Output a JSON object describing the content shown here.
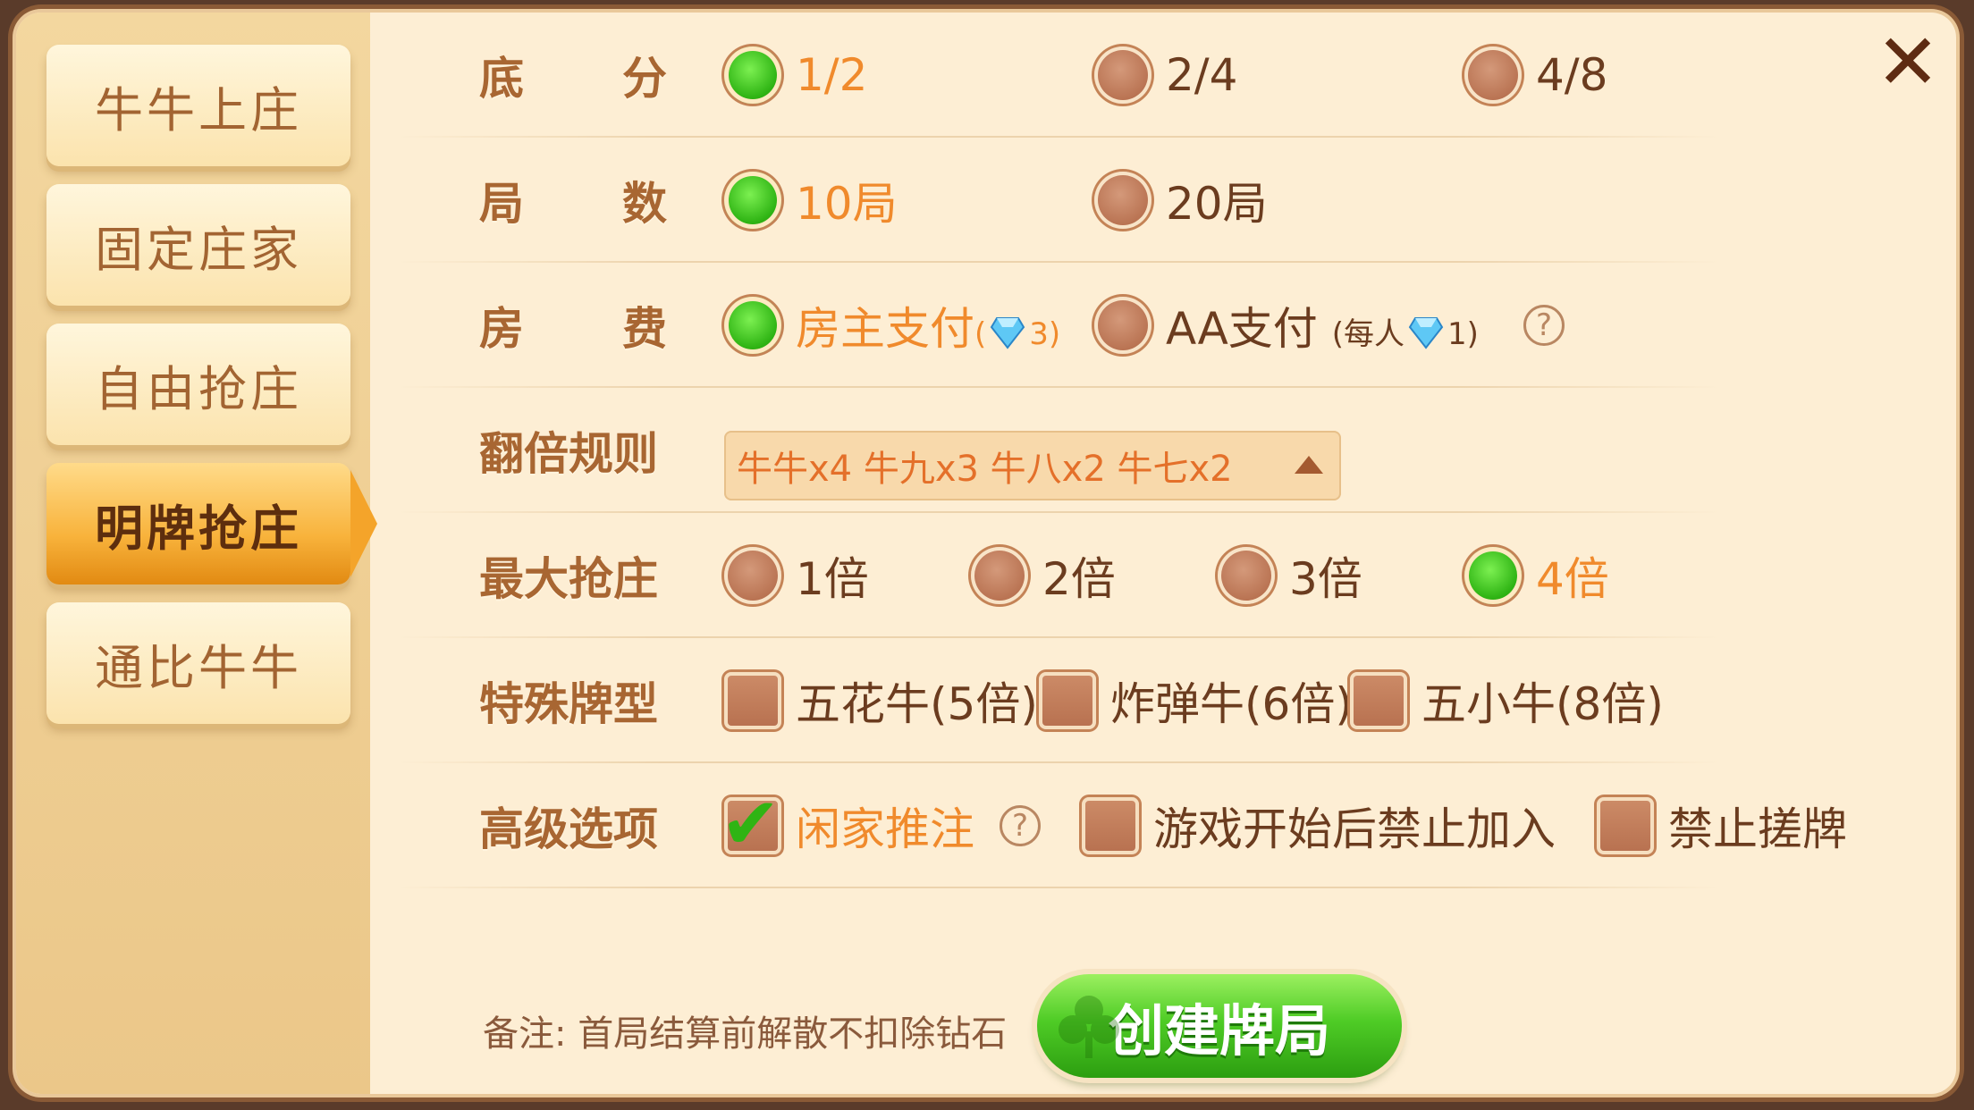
{
  "sidebar": {
    "tabs": [
      {
        "label": "牛牛上庄",
        "active": false
      },
      {
        "label": "固定庄家",
        "active": false
      },
      {
        "label": "自由抢庄",
        "active": false
      },
      {
        "label": "明牌抢庄",
        "active": true
      },
      {
        "label": "通比牛牛",
        "active": false
      }
    ]
  },
  "rows": {
    "base_score": {
      "label_a": "底",
      "label_b": "分",
      "options": [
        {
          "label": "1/2",
          "selected": true
        },
        {
          "label": "2/4",
          "selected": false
        },
        {
          "label": "4/8",
          "selected": false
        }
      ]
    },
    "rounds": {
      "label_a": "局",
      "label_b": "数",
      "options": [
        {
          "label": "10局",
          "selected": true
        },
        {
          "label": "20局",
          "selected": false
        }
      ]
    },
    "room_fee": {
      "label_a": "房",
      "label_b": "费",
      "options": [
        {
          "label": "房主支付",
          "paren_open": "(",
          "count": "3)",
          "selected": true
        },
        {
          "label": "AA支付",
          "paren_open": "(每人",
          "count": "1)",
          "selected": false
        }
      ],
      "help": "?"
    },
    "multiplier_rule": {
      "label": "翻倍规则",
      "value": "牛牛x4 牛九x3 牛八x2 牛七x2"
    },
    "max_grab": {
      "label": "最大抢庄",
      "options": [
        {
          "label": "1倍",
          "selected": false
        },
        {
          "label": "2倍",
          "selected": false
        },
        {
          "label": "3倍",
          "selected": false
        },
        {
          "label": "4倍",
          "selected": true
        }
      ]
    },
    "special_hands": {
      "label": "特殊牌型",
      "options": [
        {
          "label": "五花牛(5倍)",
          "checked": false
        },
        {
          "label": "炸弹牛(6倍)",
          "checked": false
        },
        {
          "label": "五小牛(8倍)",
          "checked": false
        }
      ]
    },
    "advanced": {
      "label": "高级选项",
      "options": [
        {
          "label": "闲家推注",
          "checked": true
        },
        {
          "label": "游戏开始后禁止加入",
          "checked": false
        },
        {
          "label": "禁止搓牌",
          "checked": false
        }
      ],
      "help": "?"
    }
  },
  "footer": {
    "note": "备注: 首局结算前解散不扣除钻石",
    "create_label": "创建牌局"
  },
  "close_symbol": "✕",
  "colors": {
    "selected_text": "#f08a2c",
    "radio_on": "#2fb414",
    "accent_orange": "#f8b33c"
  }
}
